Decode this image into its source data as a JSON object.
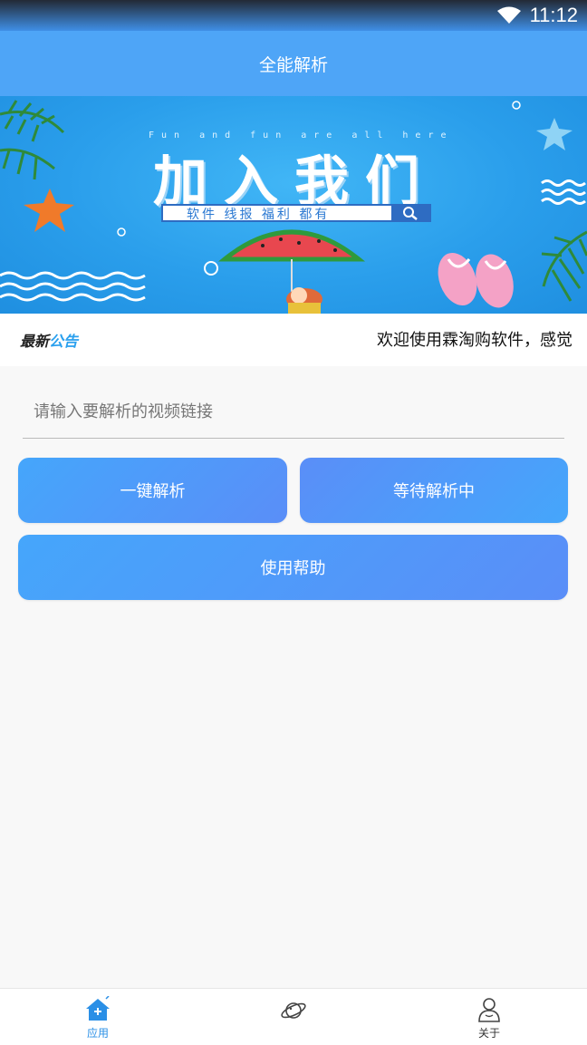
{
  "status_bar": {
    "time": "11:12"
  },
  "header": {
    "title": "全能解析"
  },
  "banner": {
    "subtitle": "Fun and fun are all here",
    "title": "加入我们",
    "search_text": "软件 线报 福利 都有"
  },
  "notice": {
    "label_a": "最新",
    "label_b": "公告",
    "text": "欢迎使用霖淘购软件，感觉"
  },
  "form": {
    "input_placeholder": "请输入要解析的视频链接",
    "input_value": ""
  },
  "buttons": {
    "parse": "一键解析",
    "waiting": "等待解析中",
    "help": "使用帮助"
  },
  "tabbar": {
    "items": [
      {
        "label": "应用",
        "icon": "home-icon",
        "active": true
      },
      {
        "label": "",
        "icon": "planet-icon",
        "active": false
      },
      {
        "label": "关于",
        "icon": "user-icon",
        "active": false
      }
    ],
    "active_color": "#2a8fe6"
  },
  "colors": {
    "header": "#4ea5f7",
    "button": "#4d9cfa"
  }
}
